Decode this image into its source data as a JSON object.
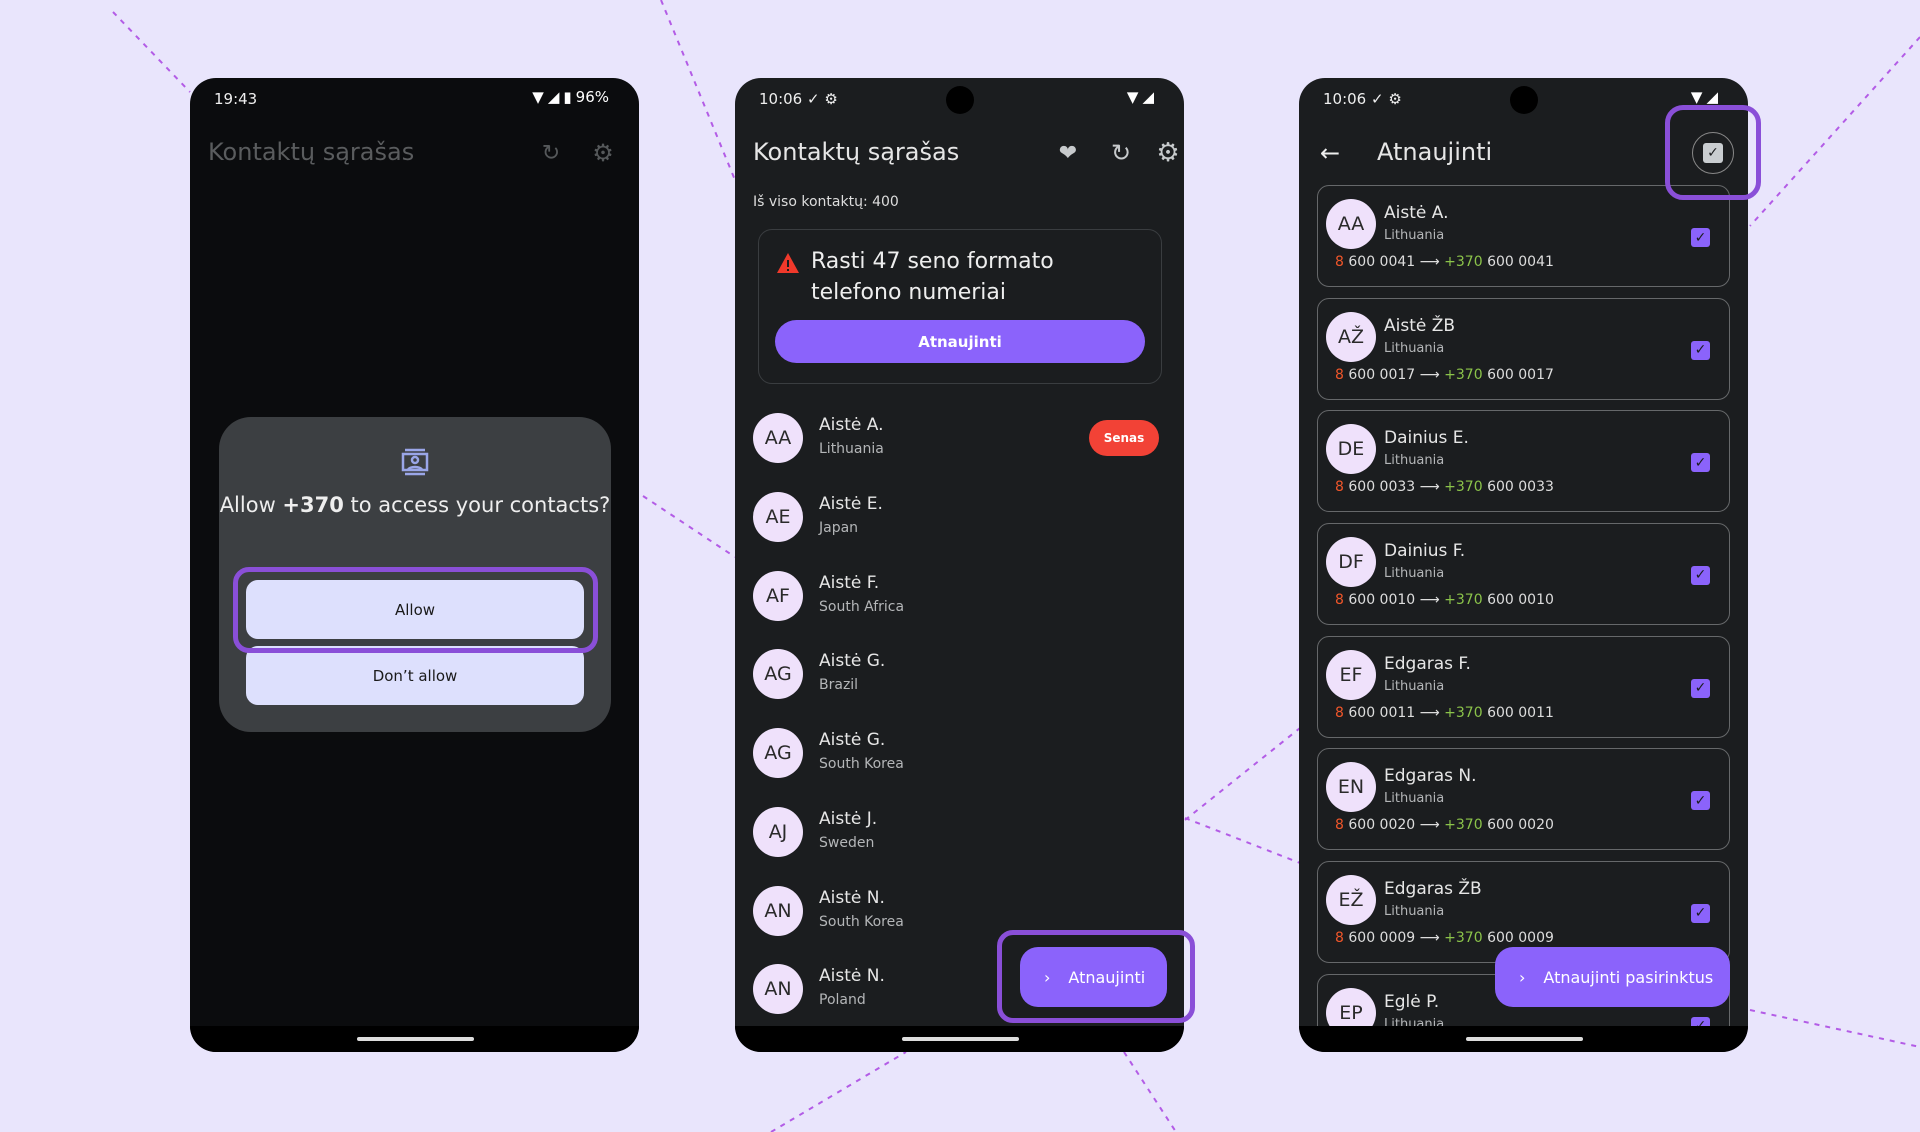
{
  "colors": {
    "background": "#e9e5fc",
    "accent": "#8b63fb",
    "highlight": "#8a4fd8",
    "badge": "#f24236",
    "old_prefix": "#f0562a",
    "new_prefix": "#8bc34a"
  },
  "phone1": {
    "status": {
      "time": "19:43",
      "battery": "96%"
    },
    "appbar": {
      "title": "Kontaktų sąrašas",
      "icons": [
        "refresh-icon",
        "gear-icon"
      ]
    },
    "dialog": {
      "icon": "contacts-icon",
      "text_pre": "Allow ",
      "app_name": "+370",
      "text_post": " to access your contacts?",
      "allow": "Allow",
      "deny": "Don’t allow"
    }
  },
  "phone2": {
    "status": {
      "time": "10:06",
      "check": "✓"
    },
    "appbar": {
      "title": "Kontaktų sąrašas",
      "icons": [
        "volunteer-icon",
        "refresh-icon",
        "gear-icon"
      ]
    },
    "total": "Iš viso kontaktų: 400",
    "warning": {
      "text": "Rasti 47 seno formato telefono numeriai",
      "button": "Atnaujinti"
    },
    "contacts": [
      {
        "initials": "AA",
        "name": "Aistė A.",
        "country": "Lithuania",
        "badge": "Senas"
      },
      {
        "initials": "AE",
        "name": "Aistė E.",
        "country": "Japan"
      },
      {
        "initials": "AF",
        "name": "Aistė F.",
        "country": "South Africa"
      },
      {
        "initials": "AG",
        "name": "Aistė G.",
        "country": "Brazil"
      },
      {
        "initials": "AG",
        "name": "Aistė G.",
        "country": "South Korea"
      },
      {
        "initials": "AJ",
        "name": "Aistė J.",
        "country": "Sweden"
      },
      {
        "initials": "AN",
        "name": "Aistė N.",
        "country": "South Korea"
      },
      {
        "initials": "AN",
        "name": "Aistė N.",
        "country": "Poland"
      }
    ],
    "fab": "Atnaujinti"
  },
  "phone3": {
    "status": {
      "time": "10:06",
      "check": "✓"
    },
    "appbar": {
      "title": "Atnaujinti"
    },
    "contacts": [
      {
        "initials": "AA",
        "name": "Aistė A.",
        "country": "Lithuania",
        "old_prefix": "8",
        "old_number": "600 0041",
        "new_prefix": "+370",
        "new_number": "600 0041",
        "checked": true
      },
      {
        "initials": "AŽ",
        "name": "Aistė ŽB",
        "country": "Lithuania",
        "old_prefix": "8",
        "old_number": "600 0017",
        "new_prefix": "+370",
        "new_number": "600 0017",
        "checked": true
      },
      {
        "initials": "DE",
        "name": "Dainius E.",
        "country": "Lithuania",
        "old_prefix": "8",
        "old_number": "600 0033",
        "new_prefix": "+370",
        "new_number": "600 0033",
        "checked": true
      },
      {
        "initials": "DF",
        "name": "Dainius F.",
        "country": "Lithuania",
        "old_prefix": "8",
        "old_number": "600 0010",
        "new_prefix": "+370",
        "new_number": "600 0010",
        "checked": true
      },
      {
        "initials": "EF",
        "name": "Edgaras F.",
        "country": "Lithuania",
        "old_prefix": "8",
        "old_number": "600 0011",
        "new_prefix": "+370",
        "new_number": "600 0011",
        "checked": true
      },
      {
        "initials": "EN",
        "name": "Edgaras N.",
        "country": "Lithuania",
        "old_prefix": "8",
        "old_number": "600 0020",
        "new_prefix": "+370",
        "new_number": "600 0020",
        "checked": true
      },
      {
        "initials": "EŽ",
        "name": "Edgaras ŽB",
        "country": "Lithuania",
        "old_prefix": "8",
        "old_number": "600 0009",
        "new_prefix": "+370",
        "new_number": "600 0009",
        "checked": true
      },
      {
        "initials": "EP",
        "name": "Eglė P.",
        "country": "Lithuania",
        "checked": true
      }
    ],
    "fab": "Atnaujinti pasirinktus"
  }
}
